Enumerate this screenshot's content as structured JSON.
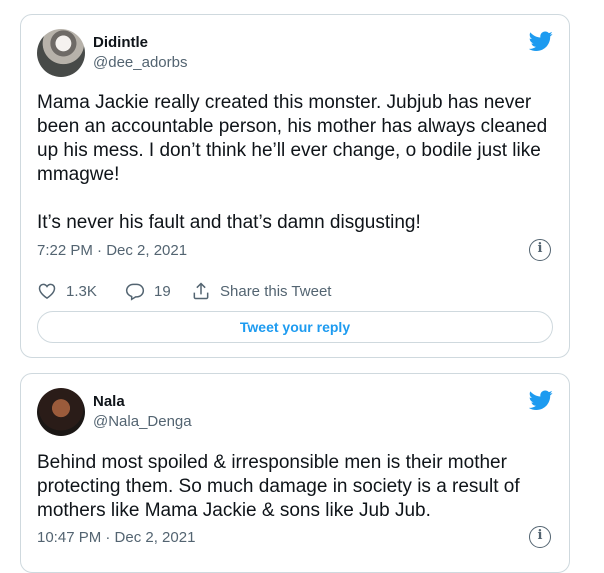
{
  "tweets": [
    {
      "name": "Didintle",
      "handle": "@dee_adorbs",
      "text": "Mama Jackie really created this monster. Jubjub has never been an accountable person, his mother has always cleaned up his mess. I don’t think he’ll ever change, o bodile just like mmagwe!\n\nIt’s never his fault and that’s damn disgusting!",
      "timestamp": "7:22 PM · Dec 2, 2021",
      "likes": "1.3K",
      "replies": "19",
      "share_label": "Share this Tweet",
      "reply_button_label": "Tweet your reply"
    },
    {
      "name": "Nala",
      "handle": "@Nala_Denga",
      "text": "Behind most spoiled & irresponsible men is their mother protecting them. So much damage in society is a result of mothers like Mama Jackie & sons like Jub Jub.",
      "timestamp": "10:47 PM · Dec 2, 2021"
    }
  ],
  "icons": {
    "brand": "twitter-bird-icon",
    "info": "info-icon",
    "like": "heart-icon",
    "reply": "reply-bubble-icon",
    "share": "share-icon"
  },
  "colors": {
    "brand": "#1d9bf0",
    "text": "#0f1419",
    "secondary": "#536471",
    "border": "#cfd9de"
  }
}
